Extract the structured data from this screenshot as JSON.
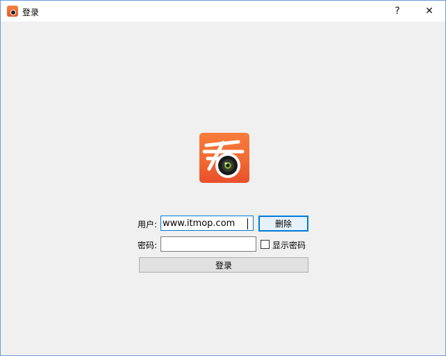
{
  "window": {
    "title": "登录",
    "help_label": "?",
    "close_label": "✕",
    "app_icon": "kan-camera-app-icon"
  },
  "logo": {
    "glyph": "看",
    "icon": "kan-camera-logo-icon"
  },
  "form": {
    "user_label": "用户:",
    "user_value": "www.itmop.com",
    "delete_label": "删除",
    "password_label": "密码:",
    "password_value": "",
    "show_password_label": "显示密码",
    "show_password_checked": false,
    "login_label": "登录"
  },
  "colors": {
    "logo_orange": "#f26a33",
    "focus_blue": "#0078d7"
  }
}
